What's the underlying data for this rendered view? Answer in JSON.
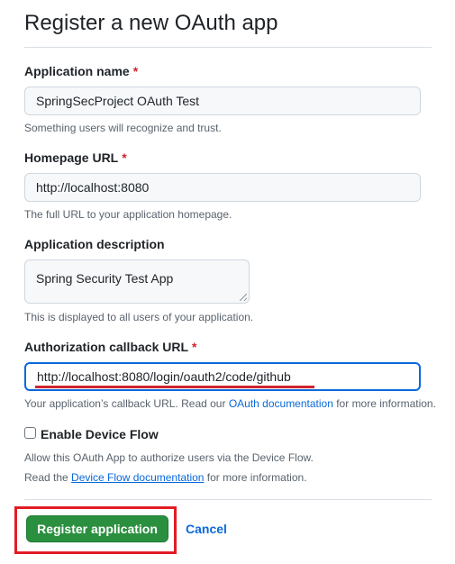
{
  "title": "Register a new OAuth app",
  "app_name": {
    "label": "Application name",
    "required_mark": "*",
    "value": "SpringSecProject OAuth Test",
    "help": "Something users will recognize and trust."
  },
  "homepage": {
    "label": "Homepage URL",
    "required_mark": "*",
    "value": "http://localhost:8080",
    "help": "The full URL to your application homepage."
  },
  "description": {
    "label": "Application description",
    "value": "Spring Security Test App",
    "help": "This is displayed to all users of your application."
  },
  "callback": {
    "label": "Authorization callback URL",
    "required_mark": "*",
    "value": "http://localhost:8080/login/oauth2/code/github",
    "help_prefix": "Your application’s callback URL. Read our ",
    "help_link": "OAuth documentation",
    "help_suffix": " for more information."
  },
  "device_flow": {
    "label": "Enable Device Flow",
    "checked": false,
    "help_line1": "Allow this OAuth App to authorize users via the Device Flow.",
    "help_line2_prefix": "Read the ",
    "help_line2_link": "Device Flow documentation",
    "help_line2_suffix": " for more information."
  },
  "actions": {
    "register_label": "Register application",
    "cancel_label": "Cancel"
  },
  "colors": {
    "primary_button": "#2a8f3f",
    "link": "#0969da",
    "required": "#d1242f",
    "annotation_highlight": "#e31c25"
  }
}
